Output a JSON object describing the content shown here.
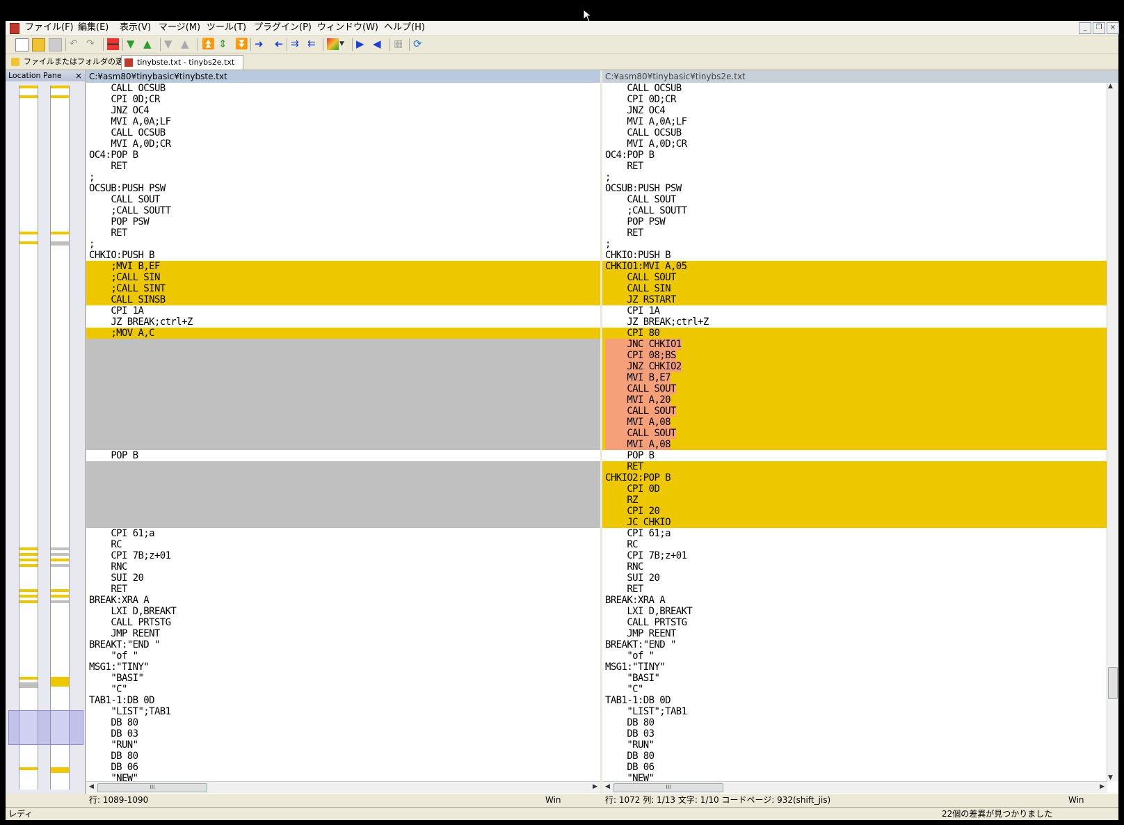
{
  "menu": [
    "ファイル(F)",
    "編集(E)",
    "表示(V)",
    "マージ(M)",
    "ツール(T)",
    "プラグイン(P)",
    "ウィンドウ(W)",
    "ヘルプ(H)"
  ],
  "tabs": [
    {
      "label": "ファイルまたはフォルダの選択..."
    },
    {
      "label": "tinybste.txt - tinybs2e.txt"
    }
  ],
  "location_pane": {
    "title": "Location Pane",
    "close": "×"
  },
  "left": {
    "path": "C:¥asm80¥tinybasic¥tinybste.txt",
    "status_line": "行: 1089-1090",
    "status_eol": "Win",
    "lines": [
      {
        "t": "    CALL OCSUB",
        "s": ""
      },
      {
        "t": "    CPI 0D;CR",
        "s": ""
      },
      {
        "t": "    JNZ OC4",
        "s": ""
      },
      {
        "t": "    MVI A,0A;LF",
        "s": ""
      },
      {
        "t": "    CALL OCSUB",
        "s": ""
      },
      {
        "t": "    MVI A,0D;CR",
        "s": ""
      },
      {
        "t": "OC4:POP B",
        "s": ""
      },
      {
        "t": "    RET",
        "s": ""
      },
      {
        "t": ";",
        "s": ""
      },
      {
        "t": "OCSUB:PUSH PSW",
        "s": ""
      },
      {
        "t": "    CALL SOUT",
        "s": ""
      },
      {
        "t": "    ;CALL SOUTT",
        "s": ""
      },
      {
        "t": "    POP PSW",
        "s": ""
      },
      {
        "t": "    RET",
        "s": ""
      },
      {
        "t": ";",
        "s": ""
      },
      {
        "t": "CHKIO:PUSH B",
        "s": ""
      },
      {
        "t": "    ;MVI B,EF",
        "s": "y"
      },
      {
        "t": "    ;CALL SIN",
        "s": "y"
      },
      {
        "t": "    ;CALL SINT",
        "s": "y"
      },
      {
        "t": "    CALL SINSB",
        "s": "y"
      },
      {
        "t": "    CPI 1A",
        "s": ""
      },
      {
        "t": "    JZ BREAK;ctrl+Z",
        "s": ""
      },
      {
        "t": "    ;MOV A,C",
        "s": "y"
      },
      {
        "t": "",
        "s": "g"
      },
      {
        "t": "",
        "s": "g"
      },
      {
        "t": "",
        "s": "g"
      },
      {
        "t": "",
        "s": "g"
      },
      {
        "t": "",
        "s": "g"
      },
      {
        "t": "",
        "s": "g"
      },
      {
        "t": "",
        "s": "g"
      },
      {
        "t": "",
        "s": "g"
      },
      {
        "t": "",
        "s": "g"
      },
      {
        "t": "",
        "s": "g"
      },
      {
        "t": "    POP B",
        "s": ""
      },
      {
        "t": "",
        "s": "g"
      },
      {
        "t": "",
        "s": "g"
      },
      {
        "t": "",
        "s": "g"
      },
      {
        "t": "",
        "s": "g"
      },
      {
        "t": "",
        "s": "g"
      },
      {
        "t": "",
        "s": "g"
      },
      {
        "t": "    CPI 61;a",
        "s": ""
      },
      {
        "t": "    RC",
        "s": ""
      },
      {
        "t": "    CPI 7B;z+01",
        "s": ""
      },
      {
        "t": "    RNC",
        "s": ""
      },
      {
        "t": "    SUI 20",
        "s": ""
      },
      {
        "t": "    RET",
        "s": ""
      },
      {
        "t": "BREAK:XRA A",
        "s": ""
      },
      {
        "t": "    LXI D,BREAKT",
        "s": ""
      },
      {
        "t": "    CALL PRTSTG",
        "s": ""
      },
      {
        "t": "    JMP REENT",
        "s": ""
      },
      {
        "t": "BREAKT:\"END \"",
        "s": ""
      },
      {
        "t": "    \"of \"",
        "s": ""
      },
      {
        "t": "MSG1:\"TINY\"",
        "s": ""
      },
      {
        "t": "    \"BASI\"",
        "s": ""
      },
      {
        "t": "    \"C\"",
        "s": ""
      },
      {
        "t": "TAB1-1:DB 0D",
        "s": ""
      },
      {
        "t": "    \"LIST\";TAB1",
        "s": ""
      },
      {
        "t": "    DB 80",
        "s": ""
      },
      {
        "t": "    DB 03",
        "s": ""
      },
      {
        "t": "    \"RUN\"",
        "s": ""
      },
      {
        "t": "    DB 80",
        "s": ""
      },
      {
        "t": "    DB 06",
        "s": ""
      },
      {
        "t": "    \"NEW\"",
        "s": ""
      }
    ]
  },
  "right": {
    "path": "C:¥asm80¥tinybasic¥tinybs2e.txt",
    "status_line": "行: 1072  列: 1/13  文字: 1/10  コードページ: 932(shift_jis)",
    "status_eol": "Win",
    "lines": [
      {
        "t": "    CALL OCSUB",
        "s": ""
      },
      {
        "t": "    CPI 0D;CR",
        "s": ""
      },
      {
        "t": "    JNZ OC4",
        "s": ""
      },
      {
        "t": "    MVI A,0A;LF",
        "s": ""
      },
      {
        "t": "    CALL OCSUB",
        "s": ""
      },
      {
        "t": "    MVI A,0D;CR",
        "s": ""
      },
      {
        "t": "OC4:POP B",
        "s": ""
      },
      {
        "t": "    RET",
        "s": ""
      },
      {
        "t": ";",
        "s": ""
      },
      {
        "t": "OCSUB:PUSH PSW",
        "s": ""
      },
      {
        "t": "    CALL SOUT",
        "s": ""
      },
      {
        "t": "    ;CALL SOUTT",
        "s": ""
      },
      {
        "t": "    POP PSW",
        "s": ""
      },
      {
        "t": "    RET",
        "s": ""
      },
      {
        "t": ";",
        "s": ""
      },
      {
        "t": "CHKIO:PUSH B",
        "s": ""
      },
      {
        "t": "CHKIO1:MVI A,05",
        "s": "y"
      },
      {
        "t": "    CALL SOUT",
        "s": "y"
      },
      {
        "t": "    CALL SIN",
        "s": "y"
      },
      {
        "t": "    JZ RSTART",
        "s": "y"
      },
      {
        "t": "    CPI 1A",
        "s": ""
      },
      {
        "t": "    JZ BREAK;ctrl+Z",
        "s": ""
      },
      {
        "t": "    CPI 80",
        "s": "y"
      },
      {
        "t": "    JNC CHKIO1",
        "s": "o"
      },
      {
        "t": "    CPI 08;BS",
        "s": "o"
      },
      {
        "t": "    JNZ CHKIO2",
        "s": "o"
      },
      {
        "t": "    MVI B,E7",
        "s": "o"
      },
      {
        "t": "    CALL SOUT",
        "s": "o"
      },
      {
        "t": "    MVI A,20",
        "s": "o"
      },
      {
        "t": "    CALL SOUT",
        "s": "o"
      },
      {
        "t": "    MVI A,08",
        "s": "o"
      },
      {
        "t": "    CALL SOUT",
        "s": "o"
      },
      {
        "t": "    MVI A,08",
        "s": "o"
      },
      {
        "t": "    POP B",
        "s": ""
      },
      {
        "t": "    RET",
        "s": "y"
      },
      {
        "t": "CHKIO2:POP B",
        "s": "y"
      },
      {
        "t": "    CPI 0D",
        "s": "y"
      },
      {
        "t": "    RZ",
        "s": "y"
      },
      {
        "t": "    CPI 20",
        "s": "y"
      },
      {
        "t": "    JC CHKIO",
        "s": "y"
      },
      {
        "t": "    CPI 61;a",
        "s": ""
      },
      {
        "t": "    RC",
        "s": ""
      },
      {
        "t": "    CPI 7B;z+01",
        "s": ""
      },
      {
        "t": "    RNC",
        "s": ""
      },
      {
        "t": "    SUI 20",
        "s": ""
      },
      {
        "t": "    RET",
        "s": ""
      },
      {
        "t": "BREAK:XRA A",
        "s": ""
      },
      {
        "t": "    LXI D,BREAKT",
        "s": ""
      },
      {
        "t": "    CALL PRTSTG",
        "s": ""
      },
      {
        "t": "    JMP REENT",
        "s": ""
      },
      {
        "t": "BREAKT:\"END \"",
        "s": ""
      },
      {
        "t": "    \"of \"",
        "s": ""
      },
      {
        "t": "MSG1:\"TINY\"",
        "s": ""
      },
      {
        "t": "    \"BASI\"",
        "s": ""
      },
      {
        "t": "    \"C\"",
        "s": ""
      },
      {
        "t": "TAB1-1:DB 0D",
        "s": ""
      },
      {
        "t": "    \"LIST\";TAB1",
        "s": ""
      },
      {
        "t": "    DB 80",
        "s": ""
      },
      {
        "t": "    DB 03",
        "s": ""
      },
      {
        "t": "    \"RUN\"",
        "s": ""
      },
      {
        "t": "    DB 80",
        "s": ""
      },
      {
        "t": "    DB 06",
        "s": ""
      },
      {
        "t": "    \"NEW\"",
        "s": ""
      }
    ]
  },
  "statusbar": {
    "left": "レディ",
    "right": "22個の差異が見つかりました"
  },
  "colors": {
    "diff": "#edc800",
    "missing": "#c0c0c0",
    "word_diff": "#f6a07a",
    "active_header": "#b9c9de"
  },
  "scrollbar_grip": "III"
}
